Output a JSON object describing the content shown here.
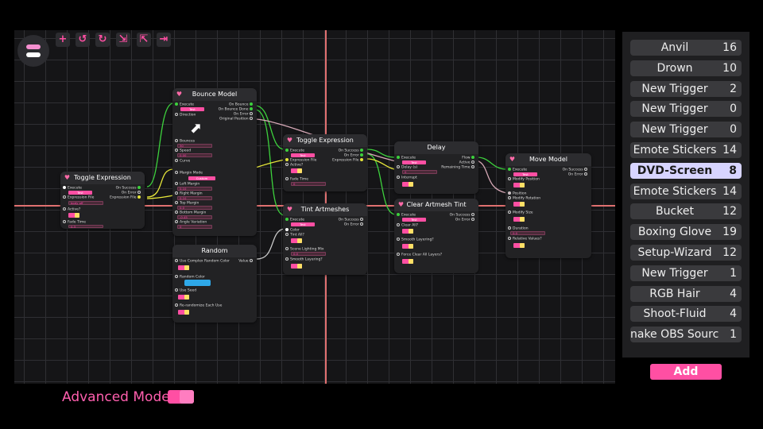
{
  "toolbar": {
    "buttons": [
      {
        "name": "add-node-button",
        "icon": "+"
      },
      {
        "name": "undo-button",
        "icon": "↺"
      },
      {
        "name": "redo-button",
        "icon": "↻"
      },
      {
        "name": "export-button",
        "icon": "⇲"
      },
      {
        "name": "share-button",
        "icon": "⇱"
      },
      {
        "name": "import-button",
        "icon": "⇥"
      }
    ]
  },
  "nodes": {
    "toggle1": {
      "title": "Toggle Expression",
      "execute": "Execute",
      "test": "Test",
      "exprfile": "Expression File",
      "exprval": "body off",
      "active": "Active?",
      "fade": "Fade Time",
      "fadeval": "0.3",
      "onsuccess": "On Success",
      "onerror": "On Error",
      "exprout": "Expression File"
    },
    "bounce": {
      "title": "Bounce Model",
      "execute": "Execute",
      "test": "Test",
      "direction": "Direction",
      "onbounce": "On Bounce",
      "onbouncedone": "On Bounce Done",
      "onerror": "On Error",
      "origpos": "Original Position",
      "bounces": "Bounces",
      "bouncesval": "30",
      "speed": "Speed",
      "speedval": "0.00",
      "curve": "Curve",
      "margin": "Margin Mode",
      "custom": "Custom",
      "left": "Left Margin",
      "leftval": "0.10",
      "right": "Right Margin",
      "rightval": "0.10",
      "top": "Top Margin",
      "topval": "0.0",
      "bottom": "Bottom Margin",
      "bottomval": "-0.45",
      "angle": "Angle Variation",
      "angleval": "0"
    },
    "random": {
      "title": "Random",
      "usecomplex": "Use Complex Random Color",
      "randomcolor": "Random Color",
      "useseed": "Use Seed",
      "rerand": "Re-randomize Each Use",
      "value": "Value"
    },
    "toggle2": {
      "title": "Toggle Expression",
      "execute": "Execute",
      "test": "Test",
      "exprfile": "Expression File",
      "active": "Active?",
      "fade": "Fade Time",
      "fadeval": "0",
      "onsuccess": "On Success",
      "onerror": "On Error",
      "exprout": "Expression File"
    },
    "tint": {
      "title": "Tint Artmeshes",
      "execute": "Execute",
      "test": "Test",
      "color": "Color",
      "tintall": "Tint All?",
      "scene": "Scene Lighting Mix",
      "sceneval": "0.0",
      "smooth": "Smooth Layering?",
      "onsuccess": "On Success",
      "onerror": "On Error"
    },
    "delay": {
      "title": "Delay",
      "execute": "Execute",
      "test": "Test",
      "delay": "Delay (s)",
      "delayval": "0",
      "interrupt": "Interrupt",
      "flow": "Flow",
      "active": "Active",
      "remaining": "Remaining Time"
    },
    "clear": {
      "title": "Clear Artmesh Tint",
      "execute": "Execute",
      "test": "Test",
      "clearall": "Clear All?",
      "smooth": "Smooth Layering?",
      "force": "Force Clear All Layers?",
      "onsuccess": "On Success",
      "onerror": "On Error"
    },
    "move": {
      "title": "Move Model",
      "execute": "Execute",
      "test": "Test",
      "modpos": "Modify Position",
      "position": "Position",
      "modrot": "Modify Rotation",
      "modsize": "Modify Size",
      "duration": "Duration",
      "durval": "0.0",
      "relative": "Relative Values?",
      "onsuccess": "On Success",
      "onerror": "On Error"
    }
  },
  "triggers": [
    {
      "name": "Anvil",
      "count": "16"
    },
    {
      "name": "Drown",
      "count": "10"
    },
    {
      "name": "New Trigger",
      "count": "2"
    },
    {
      "name": "New Trigger",
      "count": "0"
    },
    {
      "name": "New Trigger",
      "count": "0"
    },
    {
      "name": "Emote Stickers",
      "count": "14"
    },
    {
      "name": "DVD-Screen",
      "count": "8",
      "selected": true
    },
    {
      "name": "Emote Stickers",
      "count": "14"
    },
    {
      "name": "Bucket",
      "count": "12"
    },
    {
      "name": "Boxing Glove",
      "count": "19"
    },
    {
      "name": "Setup-Wizard",
      "count": "12"
    },
    {
      "name": "New Trigger",
      "count": "1"
    },
    {
      "name": "RGB Hair",
      "count": "4"
    },
    {
      "name": "Shoot-Fluid",
      "count": "4"
    },
    {
      "name": "nake OBS Source",
      "count": "1"
    }
  ],
  "add_label": "Add",
  "advanced_label": "Advanced Mode",
  "colors": {
    "accent": "#ff4fa3",
    "selected": "#d7d4ff",
    "axis": "#e07070",
    "exec_pin": "#3dd13d",
    "data_pin": "#e6e63a"
  }
}
